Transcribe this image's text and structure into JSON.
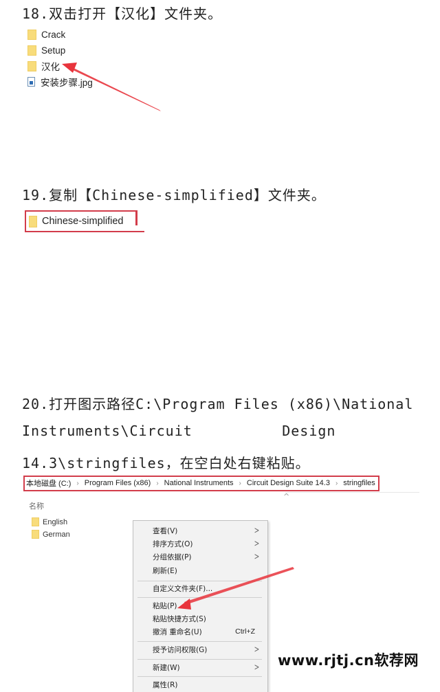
{
  "step18": {
    "title": "18.双击打开【汉化】文件夹。",
    "files": [
      {
        "name": "Crack",
        "type": "folder"
      },
      {
        "name": "Setup",
        "type": "folder"
      },
      {
        "name": "汉化",
        "type": "folder"
      },
      {
        "name": "安装步骤.jpg",
        "type": "image"
      }
    ]
  },
  "step19": {
    "title": "19.复制【Chinese-simplified】文件夹。",
    "folder": "Chinese-simplified"
  },
  "step20": {
    "title_line1": "20.打开图示路径C:\\Program Files (x86)\\National",
    "title_line2": "Instruments\\Circuit          Design",
    "title_line3": "14.3\\stringfiles，在空白处右键粘贴。",
    "breadcrumb": [
      "本地磁盘 (C:)",
      "Program Files (x86)",
      "National Instruments",
      "Circuit Design Suite 14.3",
      "stringfiles"
    ],
    "breadcrumb_sep": "›",
    "column_header": "名称",
    "sort_indicator": "^",
    "files": [
      {
        "name": "English",
        "type": "folder"
      },
      {
        "name": "German",
        "type": "folder"
      }
    ],
    "context_menu": [
      {
        "label": "查看(V)",
        "submenu": true
      },
      {
        "label": "排序方式(O)",
        "submenu": true
      },
      {
        "label": "分组依据(P)",
        "submenu": true
      },
      {
        "label": "刷新(E)"
      },
      {
        "separator": true
      },
      {
        "label": "自定义文件夹(F)..."
      },
      {
        "separator": true
      },
      {
        "label": "粘贴(P)"
      },
      {
        "label": "粘贴快捷方式(S)"
      },
      {
        "label": "撤消 重命名(U)",
        "shortcut": "Ctrl+Z"
      },
      {
        "separator": true
      },
      {
        "label": "授予访问权限(G)",
        "submenu": true
      },
      {
        "separator": true
      },
      {
        "label": "新建(W)",
        "submenu": true
      },
      {
        "separator": true
      },
      {
        "label": "属性(R)"
      }
    ],
    "submenu_arrow": ">"
  },
  "watermark": "www.rjtj.cn软荐网",
  "colors": {
    "highlight_red": "#d23c4a",
    "arrow_red": "#e8343c",
    "folder_yellow": "#f8dc7b"
  }
}
